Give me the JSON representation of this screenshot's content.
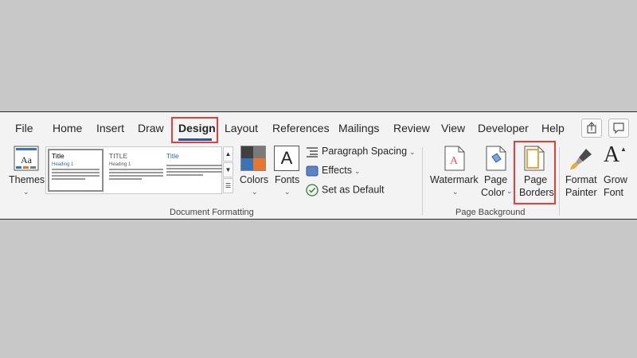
{
  "tabs": [
    {
      "label": "File"
    },
    {
      "label": "Home"
    },
    {
      "label": "Insert"
    },
    {
      "label": "Draw"
    },
    {
      "label": "Design",
      "active": true
    },
    {
      "label": "Layout"
    },
    {
      "label": "References"
    },
    {
      "label": "Mailings"
    },
    {
      "label": "Review"
    },
    {
      "label": "View"
    },
    {
      "label": "Developer"
    },
    {
      "label": "Help"
    }
  ],
  "top_right_icons": [
    "share-icon",
    "comments-icon"
  ],
  "document_formatting": {
    "group_label": "Document Formatting",
    "themes_label": "Themes",
    "styles": [
      {
        "title": "Title",
        "heading": "Heading 1"
      },
      {
        "title": "TITLE",
        "heading": "Heading 1"
      },
      {
        "title": "Title",
        "heading": ""
      }
    ],
    "colors_label": "Colors",
    "fonts_label": "Fonts",
    "fonts_glyph": "A",
    "paragraph_spacing_label": "Paragraph Spacing",
    "effects_label": "Effects",
    "set_default_label": "Set as Default",
    "swatch_colors": [
      "#404040",
      "#7a7a7a",
      "#3b73b9",
      "#e8762d"
    ]
  },
  "page_background": {
    "group_label": "Page Background",
    "watermark_label": "Watermark",
    "page_color_label": [
      "Page",
      "Color"
    ],
    "page_borders_label": [
      "Page",
      "Borders"
    ]
  },
  "extra": {
    "format_painter_label": [
      "Format",
      "Painter"
    ],
    "grow_font_label": [
      "Grow",
      "Font"
    ],
    "grow_font_glyph": "A"
  },
  "highlight_color": "#e0413a",
  "accent_color": "#2b579a"
}
